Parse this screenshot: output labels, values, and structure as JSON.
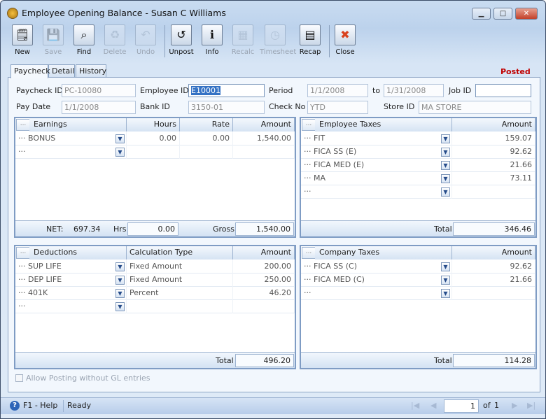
{
  "window": {
    "title": "Employee Opening Balance - Susan C Williams",
    "controls": [
      "minimize",
      "maximize",
      "close"
    ]
  },
  "toolbar": [
    {
      "label": "New",
      "icon": "new-icon",
      "enabled": true
    },
    {
      "label": "Save",
      "icon": "save-icon",
      "enabled": false
    },
    {
      "label": "Find",
      "icon": "find-icon",
      "enabled": true
    },
    {
      "label": "Delete",
      "icon": "delete-icon",
      "enabled": false
    },
    {
      "label": "Undo",
      "icon": "undo-icon",
      "enabled": false
    },
    {
      "label": "Unpost",
      "icon": "unpost-icon",
      "enabled": true
    },
    {
      "label": "Info",
      "icon": "info-icon",
      "enabled": true
    },
    {
      "label": "Recalc",
      "icon": "recalc-icon",
      "enabled": false
    },
    {
      "label": "Timesheet",
      "icon": "timesheet-icon",
      "enabled": false
    },
    {
      "label": "Recap",
      "icon": "recap-icon",
      "enabled": true
    },
    {
      "label": "Close",
      "icon": "close-icon",
      "enabled": true
    }
  ],
  "tabs": [
    "Paycheck",
    "Detail",
    "History"
  ],
  "active_tab": "Paycheck",
  "status_badge": "Posted",
  "form": {
    "paycheck_id_label": "Paycheck ID",
    "paycheck_id": "PC-10080",
    "employee_id_label": "Employee ID",
    "employee_id": "E10001",
    "period_label": "Period",
    "period_from": "1/1/2008",
    "to_label": "to",
    "period_to": "1/31/2008",
    "job_id_label": "Job ID",
    "job_id": "",
    "pay_date_label": "Pay Date",
    "pay_date": "1/1/2008",
    "bank_id_label": "Bank ID",
    "bank_id": "3150-01",
    "check_no_label": "Check No",
    "check_no": "YTD",
    "store_id_label": "Store ID",
    "store_id": "MA STORE"
  },
  "earnings": {
    "headers": [
      "Earnings",
      "Hours",
      "Rate",
      "Amount"
    ],
    "rows": [
      [
        "BONUS",
        "0.00",
        "0.00",
        "1,540.00"
      ],
      [
        "",
        "",
        "",
        ""
      ]
    ],
    "net_label": "NET:",
    "net": "697.34",
    "hrs_label": "Hrs",
    "hrs": "0.00",
    "gross_label": "Gross",
    "gross": "1,540.00"
  },
  "employee_taxes": {
    "headers": [
      "Employee Taxes",
      "Amount"
    ],
    "rows": [
      [
        "FIT",
        "159.07"
      ],
      [
        "FICA SS (E)",
        "92.62"
      ],
      [
        "FICA MED (E)",
        "21.66"
      ],
      [
        "MA",
        "73.11"
      ],
      [
        "",
        ""
      ]
    ],
    "total_label": "Total",
    "total": "346.46"
  },
  "deductions": {
    "headers": [
      "Deductions",
      "Calculation Type",
      "Amount"
    ],
    "rows": [
      [
        "SUP LIFE",
        "Fixed Amount",
        "200.00"
      ],
      [
        "DEP LIFE",
        "Fixed Amount",
        "250.00"
      ],
      [
        "401K",
        "Percent",
        "46.20"
      ],
      [
        "",
        "",
        ""
      ]
    ],
    "total_label": "Total",
    "total": "496.20"
  },
  "company_taxes": {
    "headers": [
      "Company Taxes",
      "Amount"
    ],
    "rows": [
      [
        "FICA SS (C)",
        "92.62"
      ],
      [
        "FICA MED (C)",
        "21.66"
      ],
      [
        "",
        ""
      ]
    ],
    "total_label": "Total",
    "total": "114.28"
  },
  "allow_posting_label": "Allow Posting without GL entries",
  "allow_posting_checked": false,
  "statusbar": {
    "help": "F1 - Help",
    "status": "Ready",
    "page": "1",
    "of_label": "of",
    "total_pages": "1"
  },
  "colors": {
    "posted": "#c00000",
    "selection": "#3472c4"
  }
}
